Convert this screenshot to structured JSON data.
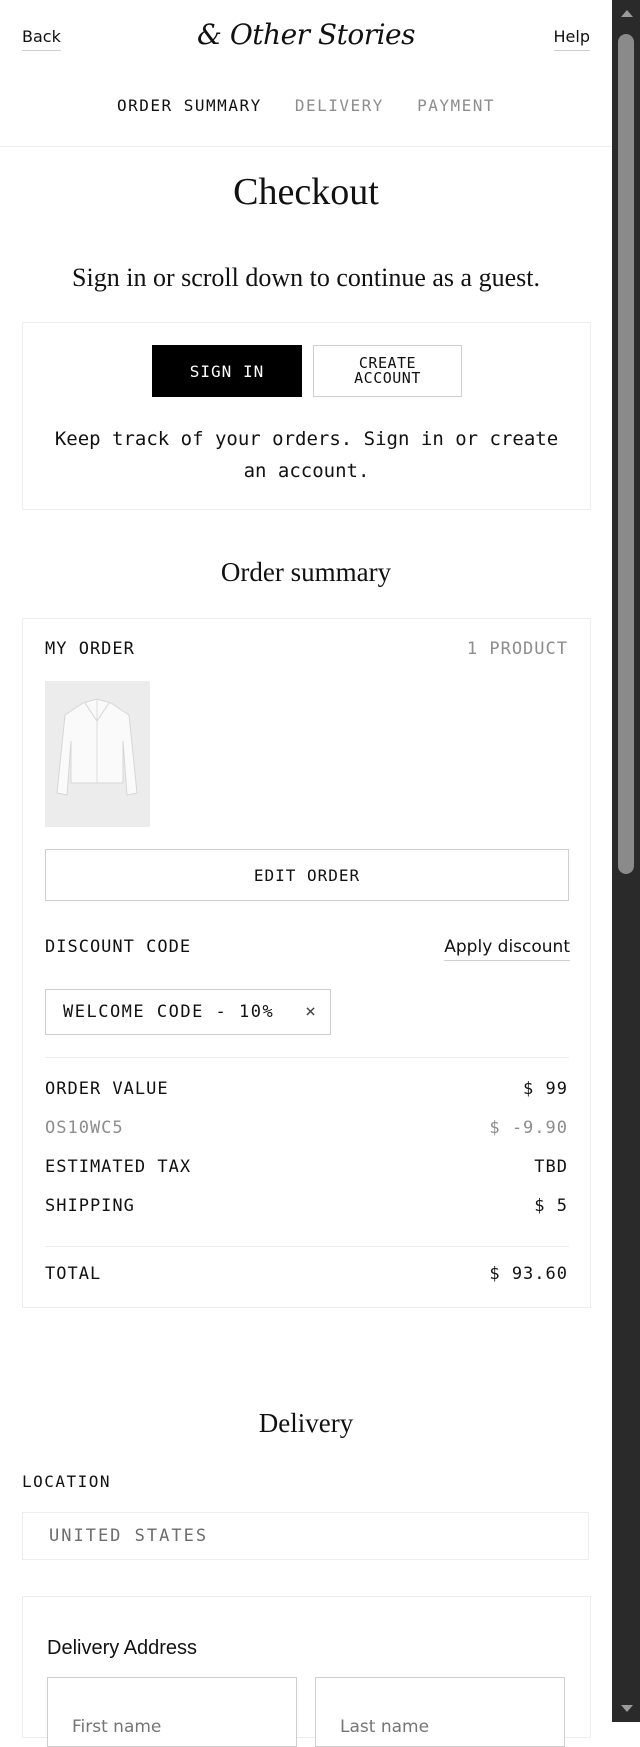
{
  "header": {
    "back_label": "Back",
    "logo_text": "& Other Stories",
    "help_label": "Help",
    "steps": [
      {
        "label": "ORDER SUMMARY",
        "active": true
      },
      {
        "label": "DELIVERY",
        "active": false
      },
      {
        "label": "PAYMENT",
        "active": false
      }
    ]
  },
  "page": {
    "title": "Checkout",
    "subtitle": "Sign in or scroll down to continue as a guest."
  },
  "signin": {
    "sign_in_label": "SIGN IN",
    "create_account_label": "CREATE ACCOUNT",
    "note": "Keep track of your orders. Sign in or create an account."
  },
  "order_summary": {
    "title": "Order summary",
    "my_order_label": "MY ORDER",
    "product_count": "1 PRODUCT",
    "edit_order_label": "EDIT ORDER",
    "discount_label": "DISCOUNT CODE",
    "apply_discount_label": "Apply discount",
    "applied_code": "WELCOME CODE - 10%",
    "remove_symbol": "×",
    "lines": [
      {
        "label": "ORDER VALUE",
        "value": "$ 99",
        "muted": false
      },
      {
        "label": "OS10WC5",
        "value": "$ -9.90",
        "muted": true
      },
      {
        "label": "ESTIMATED TAX",
        "value": "TBD",
        "muted": false
      },
      {
        "label": "SHIPPING",
        "value": "$ 5",
        "muted": false
      }
    ],
    "total_label": "TOTAL",
    "total_value": "$ 93.60"
  },
  "delivery": {
    "title": "Delivery",
    "location_label": "LOCATION",
    "location_value": "UNITED STATES",
    "address_title": "Delivery Address",
    "first_name_placeholder": "First name",
    "last_name_placeholder": "Last name"
  }
}
